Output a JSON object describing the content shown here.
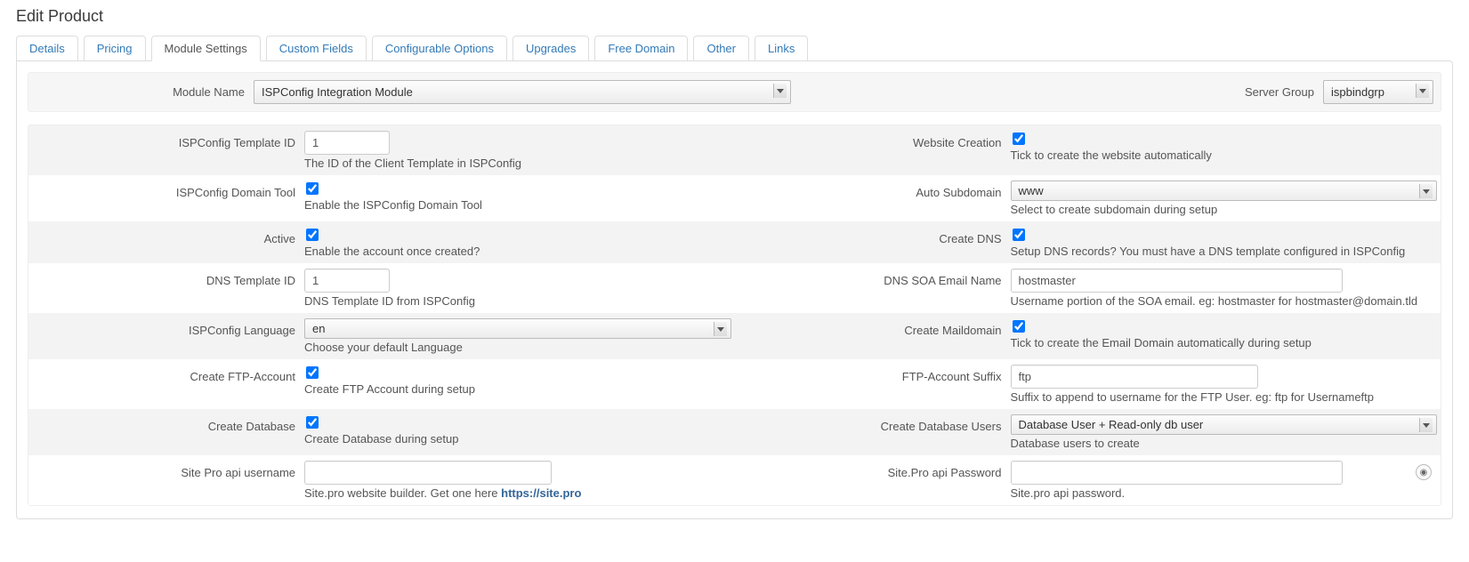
{
  "page_title": "Edit Product",
  "tabs": [
    "Details",
    "Pricing",
    "Module Settings",
    "Custom Fields",
    "Configurable Options",
    "Upgrades",
    "Free Domain",
    "Other",
    "Links"
  ],
  "active_tab_index": 2,
  "top": {
    "module_name_label": "Module Name",
    "module_name_value": "ISPConfig Integration Module",
    "server_group_label": "Server Group",
    "server_group_value": "ispbindgrp"
  },
  "left": {
    "template_id": {
      "label": "ISPConfig Template ID",
      "value": "1",
      "hint": "The ID of the Client Template in ISPConfig"
    },
    "domain_tool": {
      "label": "ISPConfig Domain Tool",
      "checked": true,
      "hint": "Enable the ISPConfig Domain Tool"
    },
    "active": {
      "label": "Active",
      "checked": true,
      "hint": "Enable the account once created?"
    },
    "dns_template_id": {
      "label": "DNS Template ID",
      "value": "1",
      "hint": "DNS Template ID from ISPConfig"
    },
    "language": {
      "label": "ISPConfig Language",
      "value": "en",
      "hint": "Choose your default Language"
    },
    "create_ftp": {
      "label": "Create FTP-Account",
      "checked": true,
      "hint": "Create FTP Account during setup"
    },
    "create_db": {
      "label": "Create Database",
      "checked": true,
      "hint": "Create Database during setup"
    },
    "sitepro_user": {
      "label": "Site Pro api username",
      "value": "",
      "hint_prefix": "Site.pro website builder. Get one here ",
      "hint_link": "https://site.pro"
    }
  },
  "right": {
    "website_creation": {
      "label": "Website Creation",
      "checked": true,
      "hint": "Tick to create the website automatically"
    },
    "auto_subdomain": {
      "label": "Auto Subdomain",
      "value": "www",
      "hint": "Select to create subdomain during setup"
    },
    "create_dns": {
      "label": "Create DNS",
      "checked": true,
      "hint": "Setup DNS records? You must have a DNS template configured in ISPConfig"
    },
    "dns_soa_email": {
      "label": "DNS SOA Email Name",
      "value": "hostmaster",
      "hint": "Username portion of the SOA email. eg: hostmaster for hostmaster@domain.tld"
    },
    "create_maildomain": {
      "label": "Create Maildomain",
      "checked": true,
      "hint": "Tick to create the Email Domain automatically during setup"
    },
    "ftp_suffix": {
      "label": "FTP-Account Suffix",
      "value": "ftp",
      "hint": "Suffix to append to username for the FTP User. eg: ftp for Usernameftp"
    },
    "create_db_users": {
      "label": "Create Database Users",
      "value": "Database User + Read-only db user",
      "hint": "Database users to create"
    },
    "sitepro_pw": {
      "label": "Site.Pro api Password",
      "value": "",
      "hint": "Site.pro api password."
    }
  }
}
